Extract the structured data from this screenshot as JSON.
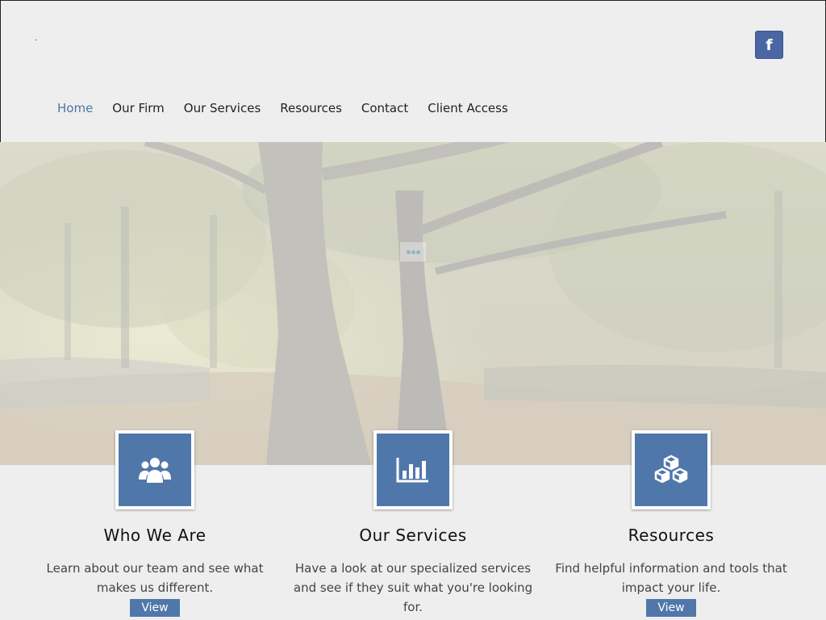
{
  "header": {
    "social": {
      "facebook_label": "f",
      "icon": "facebook-icon",
      "color": "#4a67a3"
    },
    "nav": [
      {
        "label": "Home",
        "active": true
      },
      {
        "label": "Our Firm",
        "active": false
      },
      {
        "label": "Our Services",
        "active": false
      },
      {
        "label": "Resources",
        "active": false
      },
      {
        "label": "Contact",
        "active": false
      },
      {
        "label": "Client Access",
        "active": false
      }
    ],
    "accent": "#4f75a6"
  },
  "hero": {
    "image": "autumn-park-trees",
    "loader_icon": "loading-dots-icon"
  },
  "features": [
    {
      "icon": "users-icon",
      "title": "Who We Are",
      "text": "Learn about our team and see what makes us different.",
      "button": "View"
    },
    {
      "icon": "bar-chart-icon",
      "title": "Our Services",
      "text": "Have a look at our specialized services and see if they suit what you're looking for.",
      "button": "View"
    },
    {
      "icon": "cubes-icon",
      "title": "Resources",
      "text": "Find helpful information and tools that impact your life.",
      "button": "View"
    }
  ],
  "colors": {
    "tile": "#5077aa",
    "background": "#eeeeee"
  }
}
